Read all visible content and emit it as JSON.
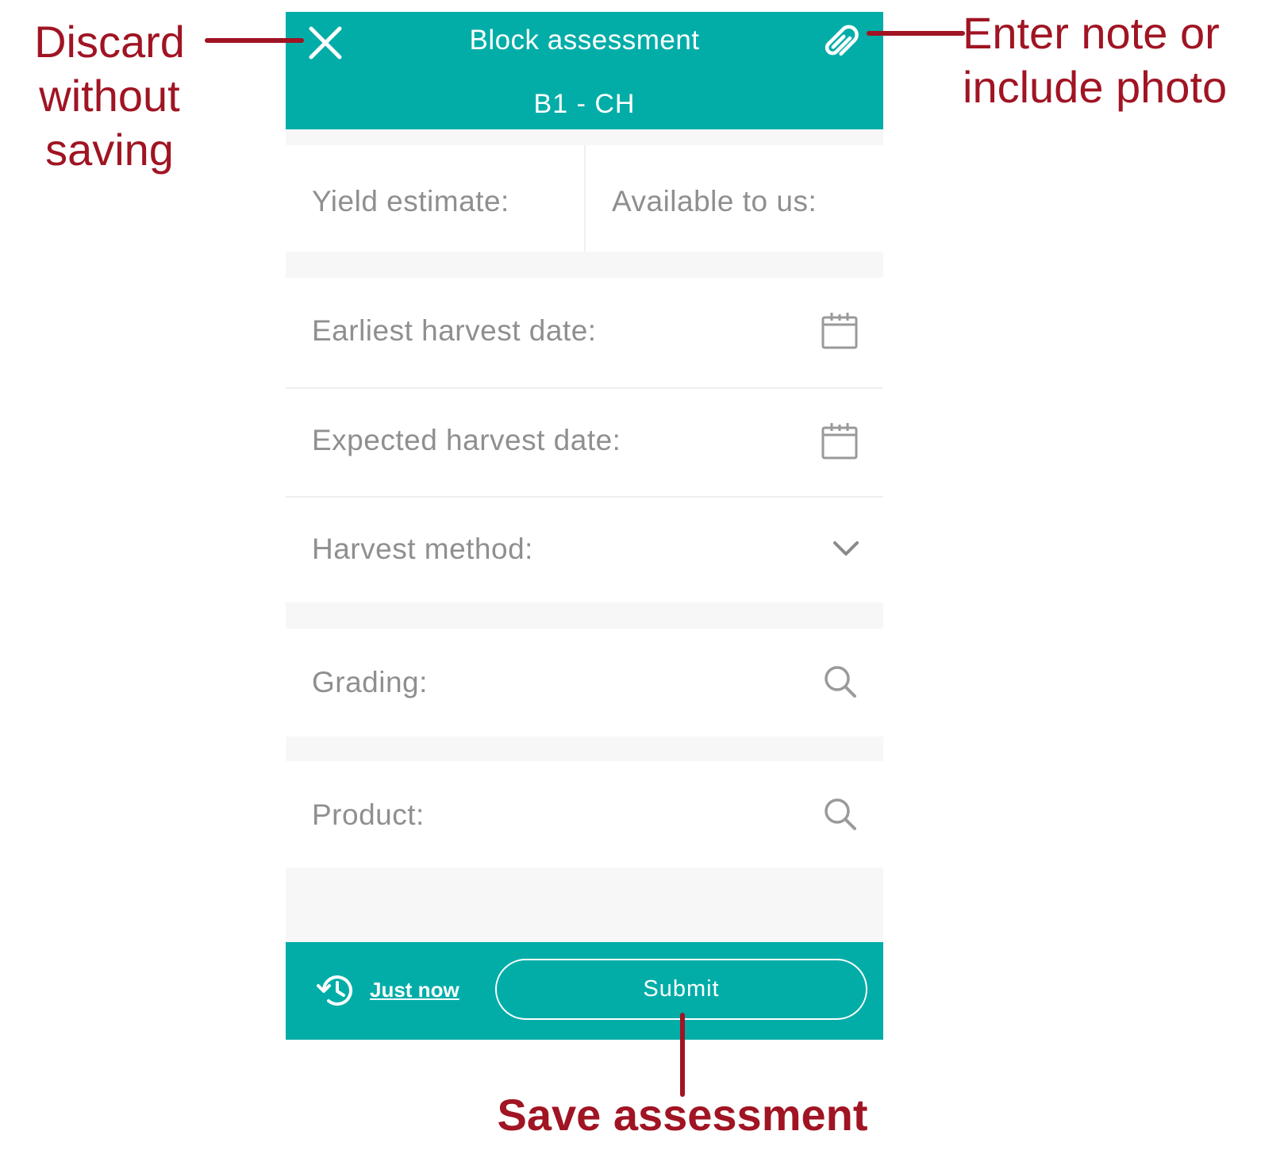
{
  "header": {
    "title": "Block assessment",
    "subtitle": "B1 - CH",
    "close_icon": "close-icon",
    "attach_icon": "paperclip-icon"
  },
  "fields": {
    "yield_estimate": "Yield estimate:",
    "available_to_us": "Available to us:",
    "earliest_harvest_date": "Earliest harvest date:",
    "expected_harvest_date": "Expected harvest date:",
    "harvest_method": "Harvest method:",
    "grading": "Grading:",
    "product": "Product:"
  },
  "footer": {
    "last_saved": "Just now",
    "submit_label": "Submit",
    "history_icon": "history-icon"
  },
  "annotations": {
    "discard_line1": "Discard",
    "discard_line2": "without",
    "discard_line3": "saving",
    "note_line1": "Enter note or",
    "note_line2": "include photo",
    "save": "Save assessment"
  },
  "colors": {
    "accent": "#02ada8",
    "annotation": "#a01423",
    "label": "#8f8f8f",
    "background": "#f7f7f7"
  }
}
